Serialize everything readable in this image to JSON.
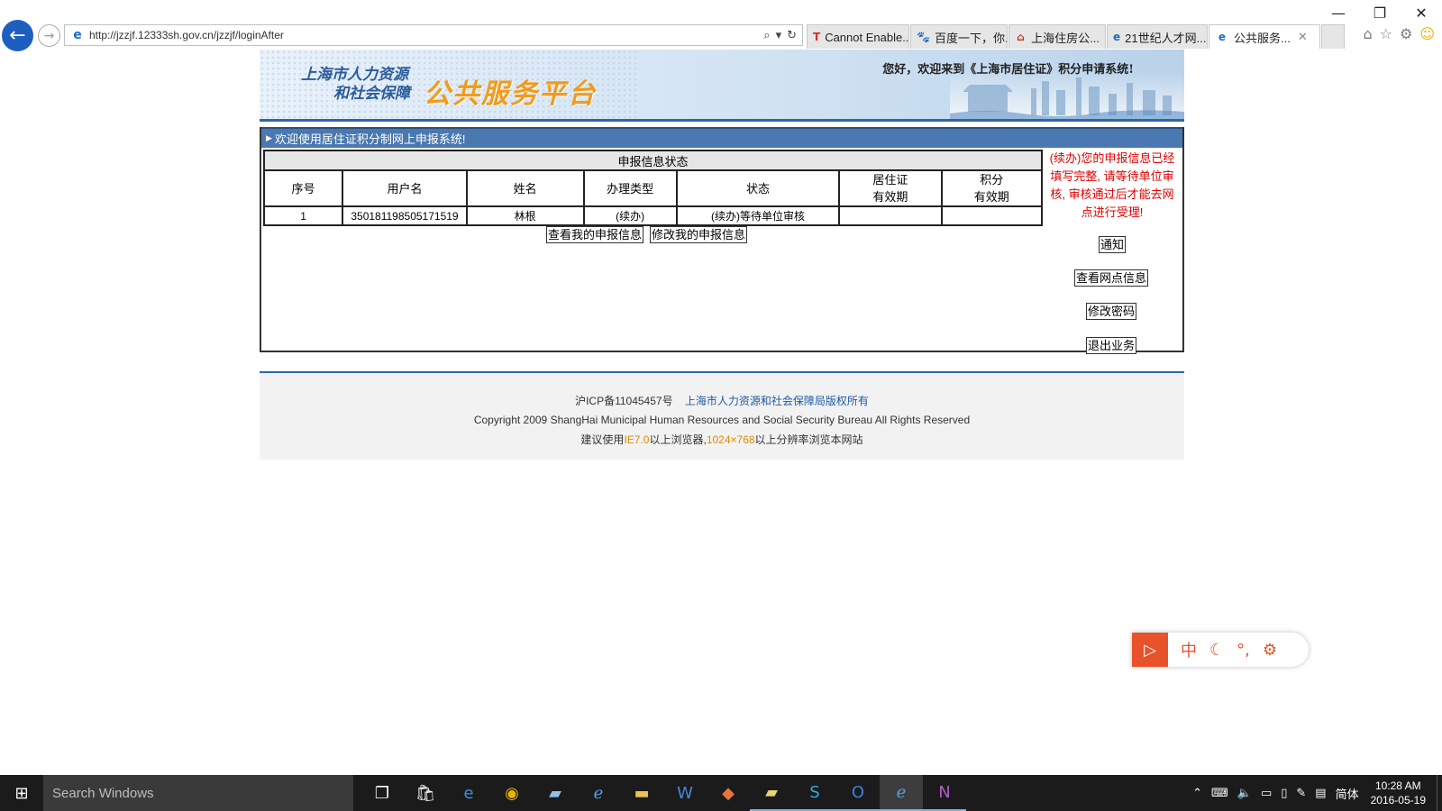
{
  "browser": {
    "address": "http://jzzjf.12333sh.gov.cn/jzzjf/loginAfter",
    "tabs": [
      {
        "label": "Cannot Enable...",
        "icon": "T",
        "color": "#d0312d",
        "active": false
      },
      {
        "label": "百度一下，你...",
        "icon": "🐾",
        "color": "#2932e1",
        "active": false
      },
      {
        "label": "上海住房公...",
        "icon": "⌂",
        "color": "#c0392b",
        "active": false
      },
      {
        "label": "21世纪人才网...",
        "icon": "e",
        "color": "#1a6fc9",
        "active": false
      },
      {
        "label": "公共服务...",
        "icon": "e",
        "color": "#1a6fc9",
        "active": true
      }
    ]
  },
  "header": {
    "logo_line1": "上海市人力资源",
    "logo_line2": "和社会保障",
    "logo_main": "公共服务平台",
    "welcome": "您好，欢迎来到《上海市居住证》积分申请系统!"
  },
  "main": {
    "bar_title": "欢迎使用居住证积分制网上申报系统!",
    "table_caption": "申报信息状态",
    "columns": {
      "no": "序号",
      "username": "用户名",
      "name": "姓名",
      "type": "办理类型",
      "status": "状态",
      "permit_l1": "居住证",
      "permit_l2": "有效期",
      "points_l1": "积分",
      "points_l2": "有效期"
    },
    "rows": [
      {
        "no": "1",
        "username": "350181198505171519",
        "name": "林根",
        "type": "(续办)",
        "status": "(续办)等待单位审核",
        "permit": "",
        "points": ""
      }
    ],
    "view_btn": "查看我的申报信息",
    "edit_btn": "修改我的申报信息"
  },
  "side": {
    "message": "(续办)您的申报信息已经填写完整, 请等待单位审核, 审核通过后才能去网点进行受理!",
    "notice_btn": "通知",
    "branch_btn": "查看网点信息",
    "pwd_btn": "修改密码",
    "exit_btn": "退出业务"
  },
  "footer": {
    "icp": "沪ICP备11045457号",
    "owner": "上海市人力资源和社会保障局版权所有",
    "copyright": "Copyright 2009 ShangHai Municipal Human Resources and Social Security Bureau All Rights Reserved",
    "suggest_pre": "建议使用",
    "ie": "IE7.0",
    "suggest_mid": "以上浏览器,",
    "res": "1024×768",
    "suggest_post": "以上分辨率浏览本网站"
  },
  "taskbar": {
    "search_placeholder": "Search Windows",
    "lang": "简体",
    "time": "10:28 AM",
    "date": "2016-05-19"
  }
}
